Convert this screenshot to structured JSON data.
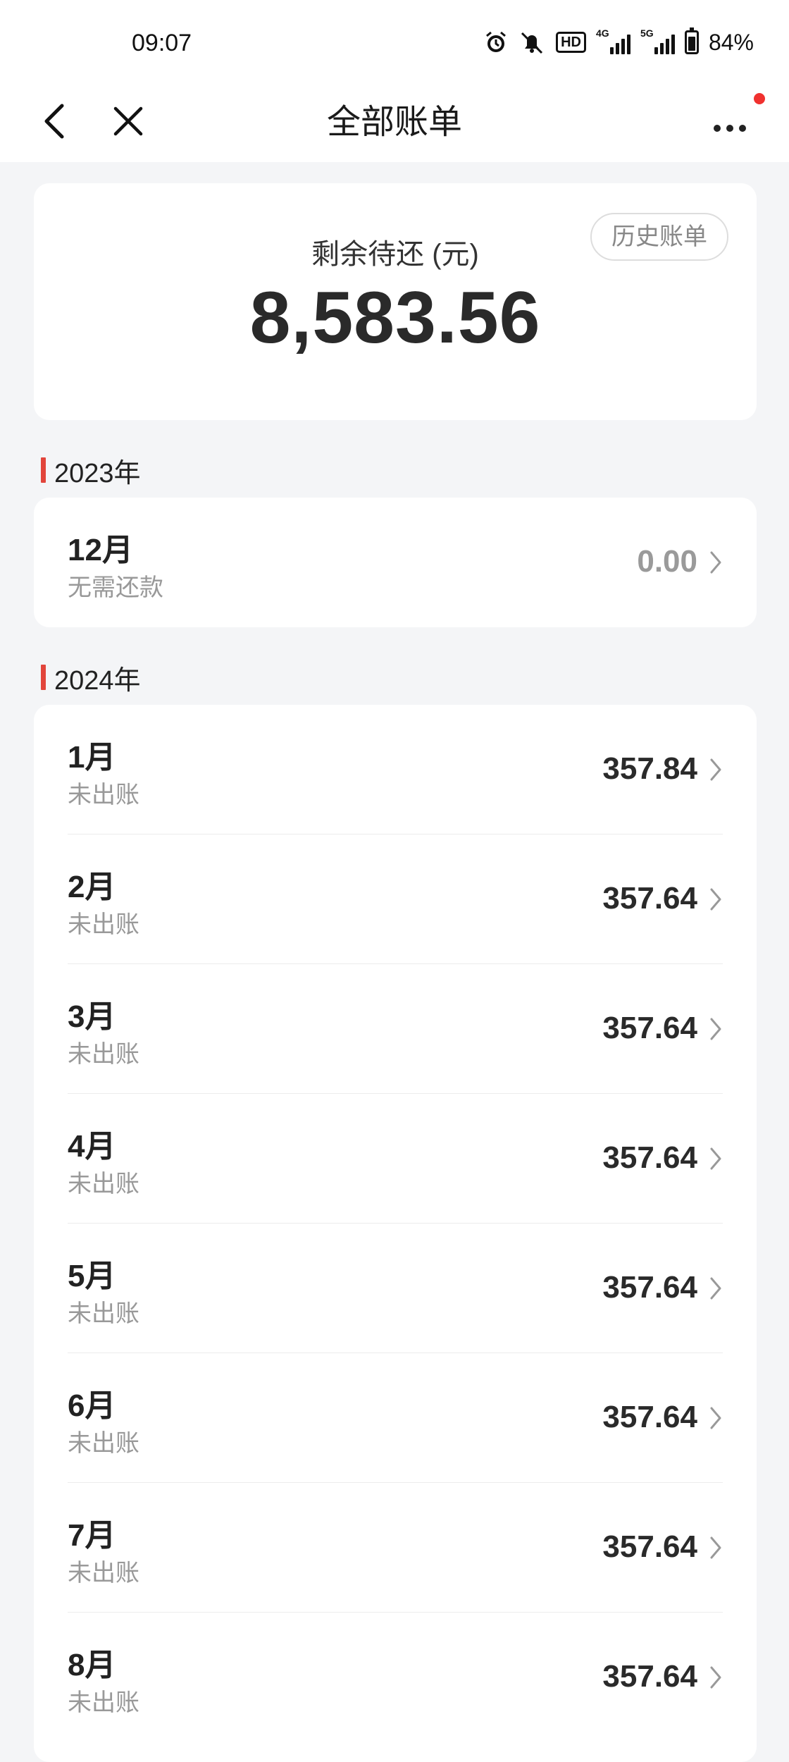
{
  "status_bar": {
    "time": "09:07",
    "hd_badge": "HD",
    "net1_tag": "4G",
    "net2_tag": "5G",
    "battery": "84%",
    "battery_level": 0.84
  },
  "nav": {
    "title": "全部账单",
    "icons": [
      "back-icon",
      "close-icon",
      "more-icon"
    ]
  },
  "summary": {
    "label": "剩余待还 (元)",
    "value": "8,583.56",
    "history_button": "历史账单"
  },
  "years": [
    {
      "year": "2023年",
      "months": [
        {
          "month": "12月",
          "status": "无需还款",
          "amount": "0.00"
        }
      ]
    },
    {
      "year": "2024年",
      "months": [
        {
          "month": "1月",
          "status": "未出账",
          "amount": "357.84"
        },
        {
          "month": "2月",
          "status": "未出账",
          "amount": "357.64"
        },
        {
          "month": "3月",
          "status": "未出账",
          "amount": "357.64"
        },
        {
          "month": "4月",
          "status": "未出账",
          "amount": "357.64"
        },
        {
          "month": "5月",
          "status": "未出账",
          "amount": "357.64"
        },
        {
          "month": "6月",
          "status": "未出账",
          "amount": "357.64"
        },
        {
          "month": "7月",
          "status": "未出账",
          "amount": "357.64"
        },
        {
          "month": "8月",
          "status": "未出账",
          "amount": "357.64"
        }
      ]
    }
  ],
  "colors": {
    "accent_red": "#e2453b",
    "notify_dot": "#f0312f",
    "background": "#f4f5f7"
  }
}
